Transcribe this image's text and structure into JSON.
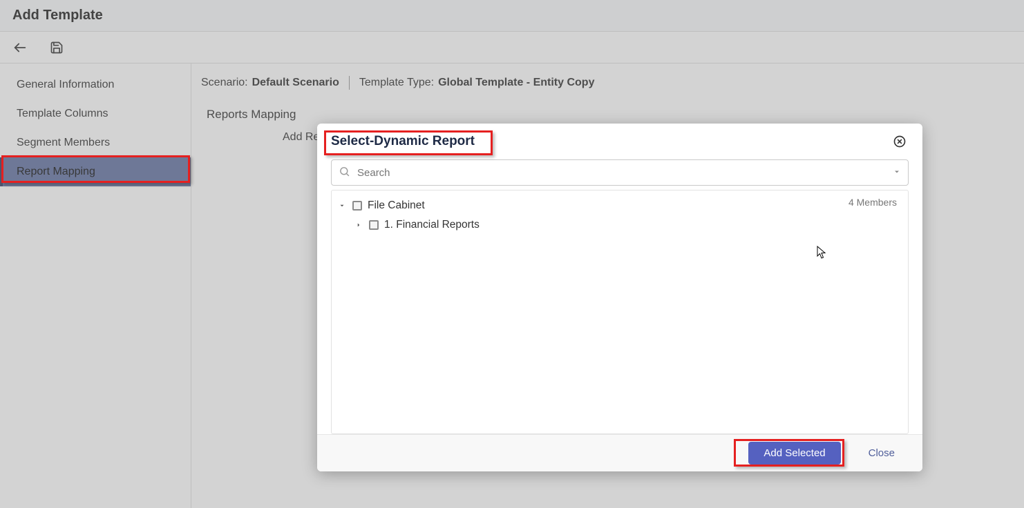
{
  "header": {
    "title": "Add Template"
  },
  "sidebar": {
    "items": [
      {
        "label": "General Information"
      },
      {
        "label": "Template Columns"
      },
      {
        "label": "Segment Members"
      },
      {
        "label": "Report Mapping"
      }
    ],
    "active_index": 3
  },
  "meta": {
    "scenario_label": "Scenario:",
    "scenario_value": "Default Scenario",
    "template_type_label": "Template Type:",
    "template_type_value": "Global Template - Entity Copy"
  },
  "section": {
    "title": "Reports Mapping",
    "add_label": "Add Re"
  },
  "modal": {
    "title": "Select-Dynamic Report",
    "search_placeholder": "Search",
    "member_count": "4 Members",
    "tree": [
      {
        "label": "File Cabinet",
        "expanded": true,
        "level": 1
      },
      {
        "label": "1. Financial Reports",
        "expanded": false,
        "level": 2
      }
    ],
    "add_selected_label": "Add Selected",
    "close_label": "Close"
  }
}
